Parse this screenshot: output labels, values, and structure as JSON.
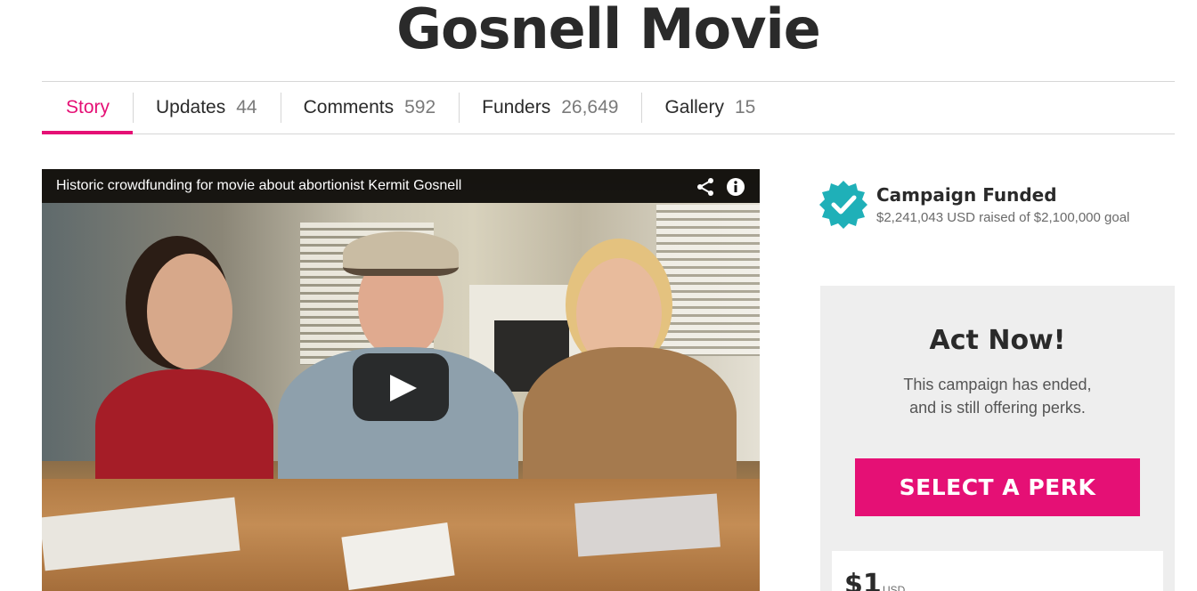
{
  "page": {
    "title": "Gosnell Movie"
  },
  "tabs": [
    {
      "label": "Story",
      "count": ""
    },
    {
      "label": "Updates",
      "count": "44"
    },
    {
      "label": "Comments",
      "count": "592"
    },
    {
      "label": "Funders",
      "count": "26,649"
    },
    {
      "label": "Gallery",
      "count": "15"
    }
  ],
  "video": {
    "title": "Historic crowdfunding for movie about abortionist Kermit Gosnell"
  },
  "campaign": {
    "status": "Campaign Funded",
    "raised_text": "$2,241,043 USD raised of $2,100,000 goal"
  },
  "act_panel": {
    "title": "Act Now!",
    "desc_line1": "This campaign has ended,",
    "desc_line2": "and is still offering perks.",
    "button_label": "SELECT A PERK"
  },
  "perk": {
    "amount": "$1",
    "currency": "USD"
  },
  "colors": {
    "accent": "#e51075",
    "badge": "#1fb0b8",
    "panel": "#eeeeee"
  }
}
